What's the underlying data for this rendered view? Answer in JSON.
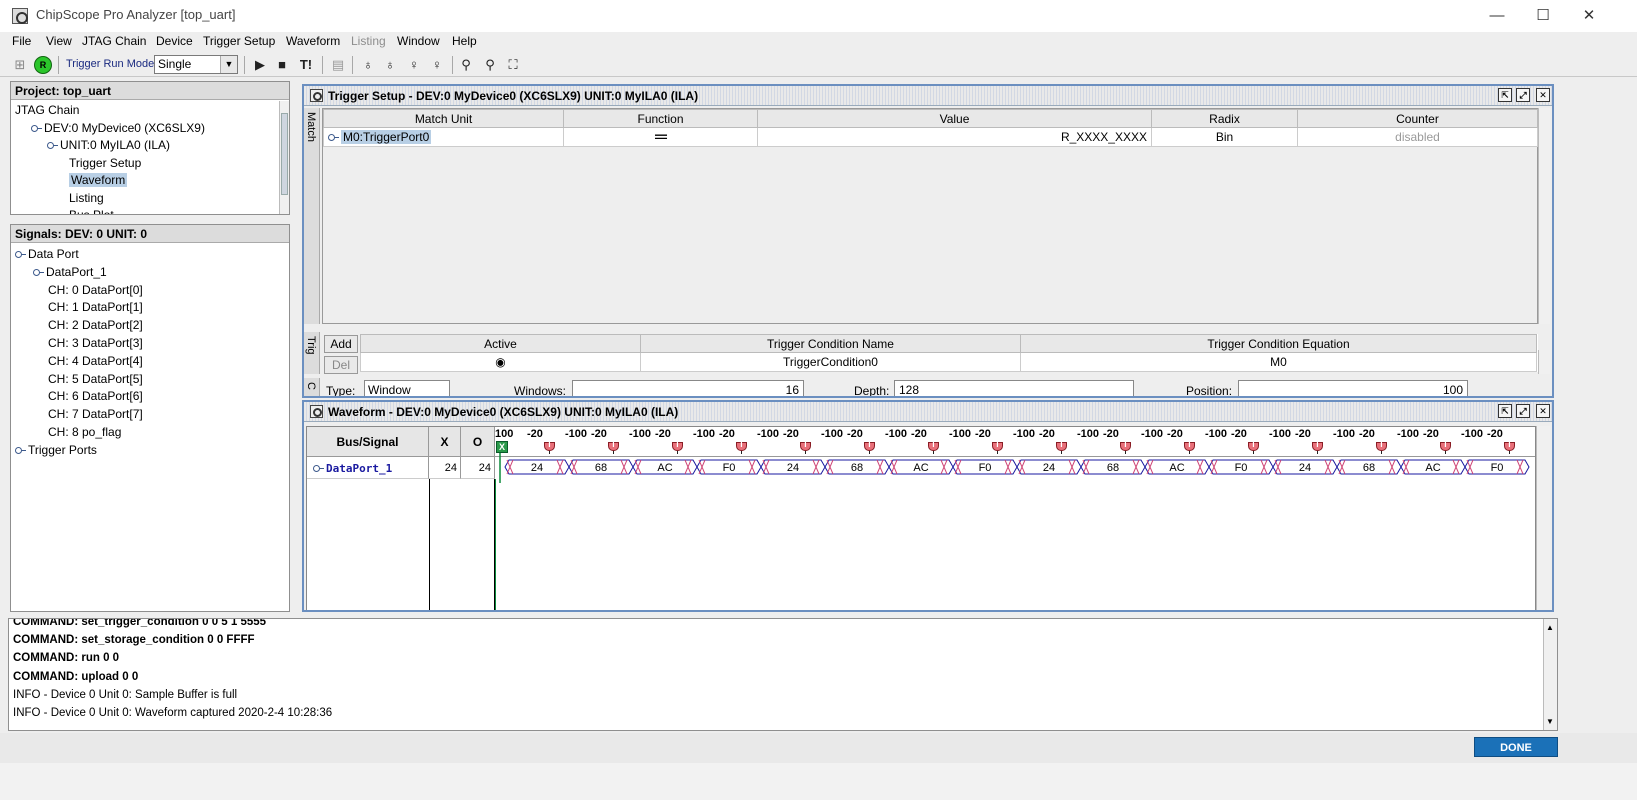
{
  "window": {
    "title": "ChipScope Pro Analyzer [top_uart]",
    "minimize": "—",
    "maximize": "☐",
    "close": "✕"
  },
  "menu": {
    "items": [
      {
        "label": "File",
        "disabled": false
      },
      {
        "label": "View",
        "disabled": false
      },
      {
        "label": "JTAG Chain",
        "disabled": false
      },
      {
        "label": "Device",
        "disabled": false
      },
      {
        "label": "Trigger Setup",
        "disabled": false
      },
      {
        "label": "Waveform",
        "disabled": false
      },
      {
        "label": "Listing",
        "disabled": true
      },
      {
        "label": "Window",
        "disabled": false
      },
      {
        "label": "Help",
        "disabled": false
      }
    ]
  },
  "toolbar": {
    "trigger_run_mode_label": "Trigger Run Mode:",
    "trigger_run_mode_value": "Single",
    "run_icon": "▶",
    "stop_icon": "■",
    "trigger_now_label": "T!",
    "status_indicator_text": "R",
    "status_color": "#2bc62b"
  },
  "project": {
    "header": "Project: top_uart",
    "tree": [
      {
        "label": "JTAG Chain",
        "indent": 0,
        "icon": false
      },
      {
        "label": "DEV:0 MyDevice0 (XC6SLX9)",
        "indent": 1,
        "icon": true
      },
      {
        "label": "UNIT:0 MyILA0 (ILA)",
        "indent": 2,
        "icon": true
      },
      {
        "label": "Trigger Setup",
        "indent": 3,
        "icon": false
      },
      {
        "label": "Waveform",
        "indent": 3,
        "icon": false,
        "selected": true
      },
      {
        "label": "Listing",
        "indent": 3,
        "icon": false
      },
      {
        "label": "Bus Plot",
        "indent": 3,
        "icon": false
      }
    ]
  },
  "signals": {
    "header": "Signals: DEV: 0 UNIT: 0",
    "tree": [
      {
        "label": "Data Port",
        "indent": 0,
        "icon": true
      },
      {
        "label": "DataPort_1",
        "indent": 1,
        "icon": true
      },
      {
        "label": "CH: 0 DataPort[0]",
        "indent": 2,
        "icon": false
      },
      {
        "label": "CH: 1 DataPort[1]",
        "indent": 2,
        "icon": false
      },
      {
        "label": "CH: 2 DataPort[2]",
        "indent": 2,
        "icon": false
      },
      {
        "label": "CH: 3 DataPort[3]",
        "indent": 2,
        "icon": false
      },
      {
        "label": "CH: 4 DataPort[4]",
        "indent": 2,
        "icon": false
      },
      {
        "label": "CH: 5 DataPort[5]",
        "indent": 2,
        "icon": false
      },
      {
        "label": "CH: 6 DataPort[6]",
        "indent": 2,
        "icon": false
      },
      {
        "label": "CH: 7 DataPort[7]",
        "indent": 2,
        "icon": false
      },
      {
        "label": "CH: 8 po_flag",
        "indent": 2,
        "icon": false
      },
      {
        "label": "Trigger Ports",
        "indent": 0,
        "icon": true
      }
    ]
  },
  "trigger_setup": {
    "title": "Trigger Setup - DEV:0 MyDevice0 (XC6SLX9) UNIT:0 MyILA0 (ILA)",
    "match_tab": "Match",
    "trig_tab": "Trig",
    "capture_tab": "C",
    "match_columns": [
      "Match Unit",
      "Function",
      "Value",
      "Radix",
      "Counter"
    ],
    "match_rows": [
      {
        "unit": "M0:TriggerPort0",
        "function": "==",
        "value": "R_XXXX_XXXX",
        "radix": "Bin",
        "counter": "disabled"
      }
    ],
    "cond_columns": [
      "Active",
      "Trigger Condition Name",
      "Trigger Condition Equation"
    ],
    "cond_rows": [
      {
        "active": "◉",
        "name": "TriggerCondition0",
        "equation": "M0"
      }
    ],
    "add_label": "Add",
    "del_label": "Del",
    "capture": {
      "type_label": "Type:",
      "type_value": "Window",
      "windows_label": "Windows:",
      "windows_value": "16",
      "depth_label": "Depth:",
      "depth_value": "128",
      "position_label": "Position:",
      "position_value": "100"
    }
  },
  "waveform": {
    "title": "Waveform - DEV:0 MyDevice0 (XC6SLX9) UNIT:0 MyILA0 (ILA)",
    "col_bus_signal": "Bus/Signal",
    "col_x": "X",
    "col_o": "O",
    "signal_name": "DataPort_1",
    "x_value": "24",
    "o_value": "24",
    "first_tick": "100",
    "tick_labels": [
      "-20",
      "-100",
      "-20",
      "-100",
      "-20",
      "-100",
      "-20",
      "-100",
      "-20",
      "-100",
      "-20",
      "-100",
      "-20",
      "-100",
      "-20",
      "-100",
      "-20",
      "-100",
      "-20",
      "-100",
      "-20",
      "-100",
      "-20",
      "-100",
      "-20",
      "-100",
      "-20",
      "-100",
      "-20",
      "-100",
      "-20",
      "-100",
      "-20"
    ],
    "marker_x_label": "X",
    "bus_values": [
      "24",
      "68",
      "AC",
      "F0",
      "24",
      "68",
      "AC",
      "F0",
      "24",
      "68",
      "AC",
      "F0",
      "24",
      "68",
      "AC",
      "F0"
    ],
    "bus_color": "#1a1aa0",
    "edge_color": "#d04878"
  },
  "console": {
    "lines": [
      {
        "text": "COMMAND: set_trigger_condition 0 0 5 1 5555",
        "cmd": true
      },
      {
        "text": "COMMAND: set_storage_condition 0 0 FFFF",
        "cmd": true
      },
      {
        "text": "COMMAND: run 0 0",
        "cmd": true
      },
      {
        "text": "COMMAND: upload 0 0",
        "cmd": true
      },
      {
        "text": "INFO - Device 0 Unit 0:  Sample Buffer is full",
        "cmd": false
      },
      {
        "text": "INFO - Device 0 Unit 0: Waveform captured 2020-2-4 10:28:36",
        "cmd": false
      }
    ]
  },
  "status": {
    "done_label": "DONE",
    "done_color": "#1b71b8"
  }
}
